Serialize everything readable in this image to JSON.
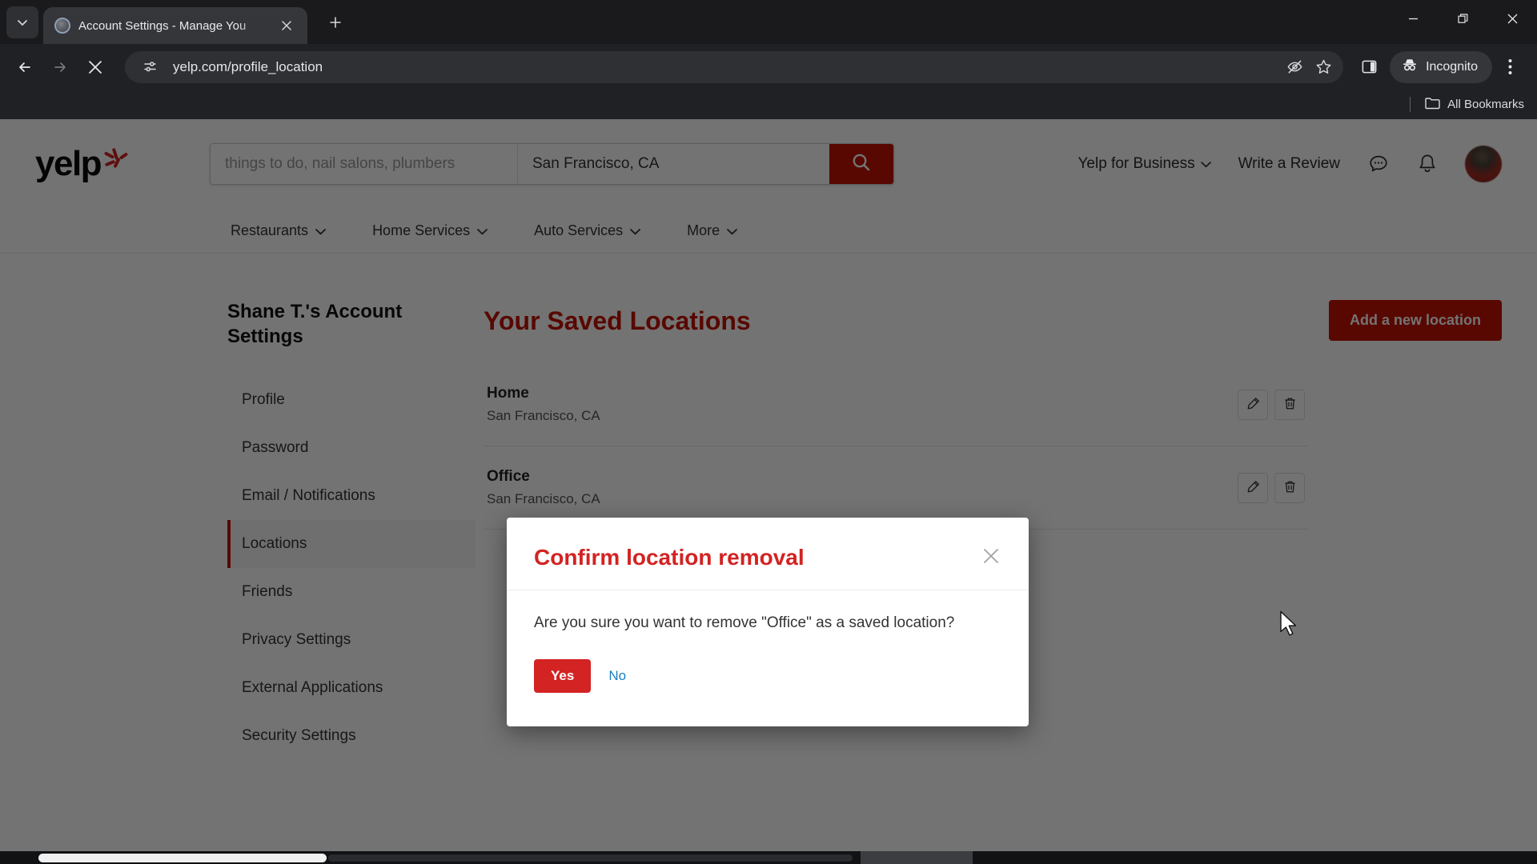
{
  "browser": {
    "tab": {
      "title": "Account Settings - Manage You",
      "favicon_name": "yelp-favicon",
      "close_label": "✕"
    },
    "new_tab_label": "+",
    "tab_list_label": "⌄",
    "window": {
      "minimize": "—",
      "restore": "❐",
      "close": "✕"
    },
    "nav": {
      "back": "←",
      "forward": "→",
      "stop": "✕"
    },
    "omnibox": {
      "url": "yelp.com/profile_location",
      "site_info_icon": "tune-icon",
      "tracking_icon": "eye-off-icon",
      "bookmark_icon": "star-icon"
    },
    "side_panel_icon": "side-panel-icon",
    "incognito_label": "Incognito",
    "menu_icon": "three-dot-menu-icon",
    "bookmarks": {
      "all_label": "All Bookmarks",
      "folder_icon": "folder-icon"
    }
  },
  "yelp": {
    "logo_text": "yelp",
    "search": {
      "find_placeholder": "things to do, nail salons, plumbers",
      "near_value": "San Francisco, CA",
      "button_icon": "search-icon"
    },
    "header_links": [
      {
        "label": "Yelp for Business",
        "caret": "⌄"
      },
      {
        "label": "Write a Review"
      }
    ],
    "header_icons": [
      {
        "name": "messages-icon"
      },
      {
        "name": "notifications-bell-icon"
      },
      {
        "name": "user-avatar"
      }
    ],
    "nav_items": [
      {
        "label": "Restaurants",
        "caret": "⌄"
      },
      {
        "label": "Home Services",
        "caret": "⌄"
      },
      {
        "label": "Auto Services",
        "caret": "⌄"
      },
      {
        "label": "More",
        "caret": "⌄"
      }
    ]
  },
  "sidebar": {
    "title": "Shane T.'s Account Settings",
    "items": [
      {
        "label": "Profile",
        "active": false
      },
      {
        "label": "Password",
        "active": false
      },
      {
        "label": "Email / Notifications",
        "active": false
      },
      {
        "label": "Locations",
        "active": true
      },
      {
        "label": "Friends",
        "active": false
      },
      {
        "label": "Privacy Settings",
        "active": false
      },
      {
        "label": "External Applications",
        "active": false
      },
      {
        "label": "Security Settings",
        "active": false
      }
    ]
  },
  "main": {
    "title": "Your Saved Locations",
    "add_button": "Add a new location",
    "rows": [
      {
        "name": "Home",
        "address": "San Francisco, CA",
        "edit_icon": "pencil-icon",
        "delete_icon": "trash-icon"
      },
      {
        "name": "Office",
        "address": "San Francisco, CA",
        "edit_icon": "pencil-icon",
        "delete_icon": "trash-icon"
      }
    ]
  },
  "modal": {
    "title": "Confirm location removal",
    "close_label": "✕",
    "message": "Are you sure you want to remove \"Office\" as a saved location?",
    "yes_label": "Yes",
    "no_label": "No"
  },
  "colors": {
    "yelp_red": "#c41200",
    "modal_red": "#d32323",
    "link_blue": "#1a7fc1",
    "chrome_bg": "#202124"
  }
}
